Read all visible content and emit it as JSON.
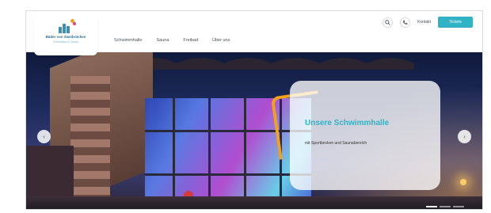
{
  "header": {
    "logo": {
      "name": "Bäder von Zweibrücken",
      "tagline": "Freizeitbad & Sauna"
    },
    "nav": [
      {
        "label": "Schwimmhalle"
      },
      {
        "label": "Sauna"
      },
      {
        "label": "Freibad"
      },
      {
        "label": "Über uns"
      }
    ],
    "tools": {
      "search_icon": "search-icon",
      "phone_icon": "phone-icon",
      "kontakt_label": "Kontakt",
      "cta_label": "Tickets"
    }
  },
  "hero": {
    "title": "Unsere Schwimmhalle",
    "subtitle": "mit Sportbecken und Saunabereich",
    "prev_icon": "chevron-left-icon",
    "next_icon": "chevron-right-icon",
    "slides": 3,
    "active_slide": 1
  },
  "colors": {
    "accent": "#2fb3c7",
    "highlight": "#f2a21a"
  }
}
